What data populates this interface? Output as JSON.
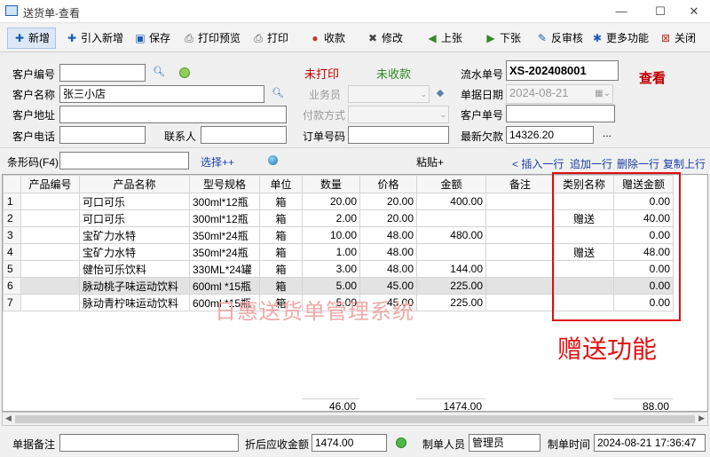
{
  "window": {
    "title": "送货单-查看"
  },
  "toolbar": [
    {
      "label": "新增",
      "icon": "plus-icon",
      "symbol": "✚",
      "color": "#1b5fb5"
    },
    {
      "label": "引入新增",
      "icon": "import-add-icon",
      "symbol": "✚",
      "color": "#1b5fb5"
    },
    {
      "label": "保存",
      "icon": "save-icon",
      "symbol": "▣",
      "color": "#1b5fb5"
    },
    {
      "label": "打印预览",
      "icon": "print-preview-icon",
      "symbol": "⎙",
      "color": "#555"
    },
    {
      "label": "打印",
      "icon": "print-icon",
      "symbol": "⎙",
      "color": "#555"
    },
    {
      "label": "收款",
      "icon": "receive-payment-icon",
      "symbol": "●",
      "color": "#c0392b"
    },
    {
      "label": "修改",
      "icon": "edit-icon",
      "symbol": "✖",
      "color": "#444"
    },
    {
      "label": "上张",
      "icon": "previous-icon",
      "symbol": "◀",
      "color": "#2e8b20"
    },
    {
      "label": "下张",
      "icon": "next-icon",
      "symbol": "▶",
      "color": "#2e8b20"
    },
    {
      "label": "反审核",
      "icon": "unapprove-icon",
      "symbol": "✎",
      "color": "#1b5fb5"
    },
    {
      "label": "更多功能",
      "icon": "more-functions-icon",
      "symbol": "✱",
      "color": "#1b5fb5"
    },
    {
      "label": "关闭",
      "icon": "close-doc-icon",
      "symbol": "⊠",
      "color": "#c0392b"
    }
  ],
  "form": {
    "customer_code_label": "客户编号",
    "customer_code": "",
    "customer_name_label": "客户名称",
    "customer_name": "张三小店",
    "customer_address_label": "客户地址",
    "customer_address": "",
    "customer_phone_label": "客户电话",
    "customer_phone": "",
    "contact_label": "联系人",
    "contact": "",
    "print_status": "未打印",
    "payment_status": "未收款",
    "salesperson_label": "业务员",
    "salesperson": "",
    "payment_method_label": "付款方式",
    "payment_method": "",
    "order_no_label": "订单号码",
    "order_no": "",
    "serial_label": "流水单号",
    "serial": "XS-202408001",
    "date_label": "单据日期",
    "date": "2024-08-21",
    "customer_doc_label": "客户单号",
    "customer_doc": "",
    "latest_debt_label": "最新欠款",
    "latest_debt": "14326.20",
    "ellipsis": "...",
    "mode_badge": "查看"
  },
  "barcode_bar": {
    "label": "条形码(F4)",
    "value": "",
    "select_link": "选择++",
    "paste_link": "粘贴+",
    "insert_row": "< 插入一行",
    "append_row": "追加一行",
    "delete_row": "删除一行",
    "copy_up": "复制上行"
  },
  "table": {
    "columns": [
      "",
      "产品编号",
      "产品名称",
      "型号规格",
      "单位",
      "数量",
      "价格",
      "金额",
      "备注",
      "类别名称",
      "赠送金额"
    ],
    "rows": [
      [
        "1",
        "",
        "可口可乐",
        "300ml*12瓶",
        "箱",
        "20.00",
        "20.00",
        "400.00",
        "",
        "",
        "0.00"
      ],
      [
        "2",
        "",
        "可口可乐",
        "300ml*12瓶",
        "箱",
        "2.00",
        "20.00",
        "",
        "",
        "赠送",
        "40.00"
      ],
      [
        "3",
        "",
        "宝矿力水特",
        "350ml*24瓶",
        "箱",
        "10.00",
        "48.00",
        "480.00",
        "",
        "",
        "0.00"
      ],
      [
        "4",
        "",
        "宝矿力水特",
        "350ml*24瓶",
        "箱",
        "1.00",
        "48.00",
        "",
        "",
        "赠送",
        "48.00"
      ],
      [
        "5",
        "",
        "健怡可乐饮料",
        "330ML*24罐",
        "箱",
        "3.00",
        "48.00",
        "144.00",
        "",
        "",
        "0.00"
      ],
      [
        "6",
        "",
        "脉动桃子味运动饮料",
        "600ml *15瓶",
        "箱",
        "5.00",
        "45.00",
        "225.00",
        "",
        "",
        "0.00"
      ],
      [
        "7",
        "",
        "脉动青柠味运动饮料",
        "600ml *15瓶",
        "箱",
        "5.00",
        "45.00",
        "225.00",
        "",
        "",
        "0.00"
      ]
    ],
    "selected_row": 6,
    "totals": {
      "quantity": "46.00",
      "amount": "1474.00",
      "gift_amount": "88.00"
    }
  },
  "watermark": "日惠送货单管理系统",
  "annotation": "赠送功能",
  "footer": {
    "remark_label": "单据备注",
    "remark": "",
    "discount_label": "折后应收金额",
    "discount_amount": "1474.00",
    "creator_label": "制单人员",
    "creator": "管理员",
    "created_time_label": "制单时间",
    "created_time": "2024-08-21 17:36:47"
  }
}
